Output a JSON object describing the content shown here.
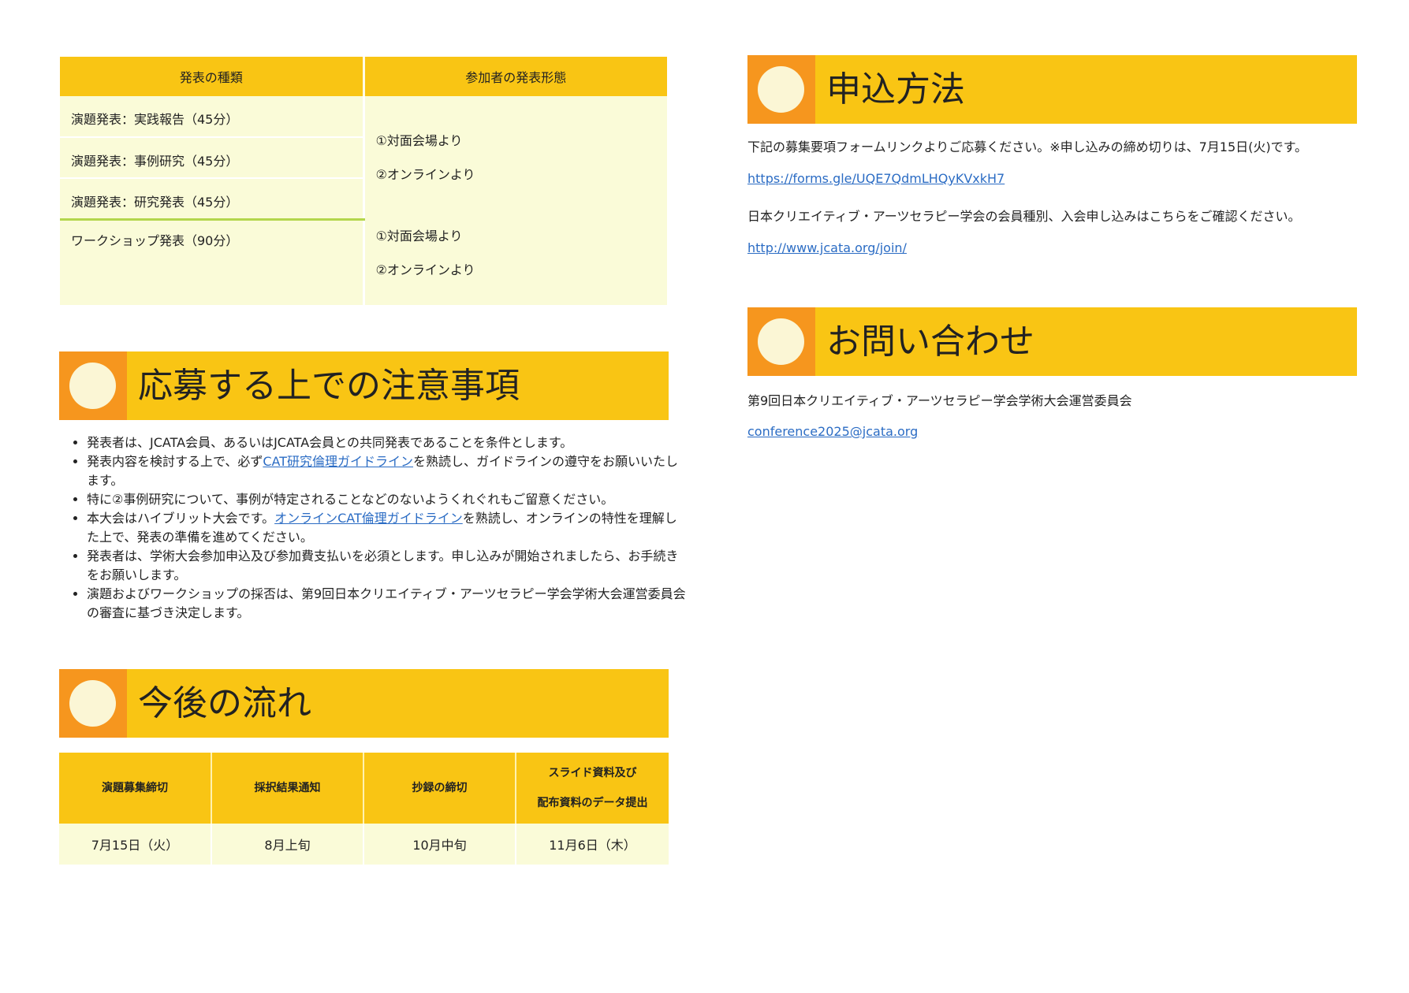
{
  "presentation_table": {
    "headers": [
      "発表の種類",
      "参加者の発表形態"
    ],
    "types": [
      "演題発表：実践報告（45分）",
      "演題発表：事例研究（45分）",
      "演題発表：研究発表（45分）"
    ],
    "formats": [
      "①対面会場より",
      "②オンラインより"
    ],
    "workshop": {
      "type": "ワークショップ発表（90分）",
      "formats": [
        "①対面会場より",
        "②オンラインより"
      ]
    }
  },
  "notes_section": {
    "title": "応募する上での注意事項",
    "items": [
      {
        "text": "発表者は、JCATA会員、あるいはJCATA会員との共同発表であることを条件とします。"
      },
      {
        "before": "発表内容を検討する上で、必ず",
        "link": "CAT研究倫理ガイドライン",
        "after": "を熟読し、ガイドラインの遵守をお願いいたします。"
      },
      {
        "text": "特に②事例研究について、事例が特定されることなどのないようくれぐれもご留意ください。"
      },
      {
        "before": "本大会はハイブリット大会です。",
        "link": "オンラインCAT倫理ガイドライン",
        "after": "を熟読し、オンラインの特性を理解した上で、発表の準備を進めてください。"
      },
      {
        "text": "発表者は、学術大会参加申込及び参加費支払いを必須とします。申し込みが開始されましたら、お手続きをお願いします。"
      },
      {
        "text": "演題およびワークショップの採否は、第9回日本クリエイティブ・アーツセラピー学会学術大会運営委員会の審査に基づき決定します。"
      }
    ]
  },
  "schedule_section": {
    "title": "今後の流れ",
    "headers": [
      "演題募集締切",
      "採択結果通知",
      "抄録の締切",
      "スライド資料及び",
      "配布資料のデータ提出"
    ],
    "values": [
      "7月15日（火）",
      "8月上旬",
      "10月中旬",
      "11月6日（木）"
    ]
  },
  "apply_section": {
    "title": "申込方法",
    "intro": "下記の募集要項フォームリンクよりご応募ください。※申し込みの締め切りは、7月15日(火)です。",
    "form_link": "https://forms.gle/UQE7QdmLHQyKVxkH7",
    "member_text": "日本クリエイティブ・アーツセラピー学会の会員種別、入会申し込みはこちらをご確認ください。",
    "member_link": "http://www.jcata.org/join/"
  },
  "contact_section": {
    "title": "お問い合わせ",
    "org": "第9回日本クリエイティブ・アーツセラピー学会学術大会運営委員会",
    "email": "conference2025@jcata.org"
  },
  "colors": {
    "header_yellow": "#f9c514",
    "accent_orange": "#f6961e",
    "cream_circle": "#fbf6d5",
    "cell_bg": "#fafbd8",
    "divider_green": "#b3d64c",
    "link_blue": "#2b6cc4"
  }
}
